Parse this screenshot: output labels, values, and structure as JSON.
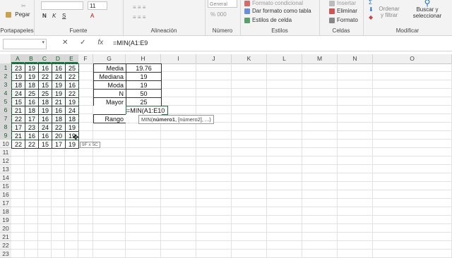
{
  "ribbon": {
    "paste_label": "Pegar",
    "groups": {
      "clipboard": "Portapapeles",
      "font": "Fuente",
      "alignment": "Alineación",
      "number": "Número",
      "styles": "Estilos",
      "cells": "Celdas",
      "modify": "Modificar"
    },
    "font_size": "11",
    "number_format": "General",
    "styles_items": [
      "Formato condicional",
      "Dar formato como tabla",
      "Estilos de celda"
    ],
    "cells_items": [
      "Insertar",
      "Eliminar",
      "Formato"
    ],
    "sort_label": "Ordenar y filtrar",
    "find_label": "Buscar y seleccionar"
  },
  "formula_bar": {
    "name_box": "",
    "cancel_icon": "✕",
    "enter_icon": "✓",
    "fx_icon": "fx",
    "formula": "=MIN(A1:E9"
  },
  "columns": [
    "A",
    "B",
    "C",
    "D",
    "E",
    "F",
    "G",
    "H",
    "I",
    "J",
    "K",
    "L",
    "M",
    "N",
    "O"
  ],
  "rows": [
    "1",
    "2",
    "3",
    "4",
    "5",
    "6",
    "7",
    "8",
    "9",
    "10",
    "11",
    "12",
    "13",
    "14",
    "15",
    "16",
    "17",
    "18",
    "19",
    "20",
    "21",
    "22",
    "23"
  ],
  "data_table": [
    [
      "23",
      "19",
      "16",
      "16",
      "25"
    ],
    [
      "19",
      "19",
      "22",
      "24",
      "22"
    ],
    [
      "18",
      "18",
      "15",
      "19",
      "16"
    ],
    [
      "24",
      "25",
      "25",
      "19",
      "22"
    ],
    [
      "15",
      "16",
      "18",
      "21",
      "19"
    ],
    [
      "21",
      "18",
      "19",
      "16",
      "24"
    ],
    [
      "22",
      "17",
      "16",
      "18",
      "18"
    ],
    [
      "17",
      "23",
      "24",
      "22",
      "19"
    ],
    [
      "21",
      "16",
      "16",
      "20",
      "19"
    ],
    [
      "22",
      "22",
      "15",
      "17",
      "19"
    ]
  ],
  "stats": {
    "labels": [
      "Media",
      "Mediana",
      "Moda",
      "N",
      "Mayor",
      "",
      "Rango"
    ],
    "values": [
      "19.76",
      "19",
      "19",
      "50",
      "25",
      "=MIN(A1:E10",
      ""
    ]
  },
  "tooltip": {
    "fn": "MIN(",
    "arg1": "número1",
    "rest": ", [número2], ...)"
  },
  "size_tip": "9F x 5C",
  "colors": {
    "accent": "#217346",
    "header_bg": "#f0f0f0"
  }
}
